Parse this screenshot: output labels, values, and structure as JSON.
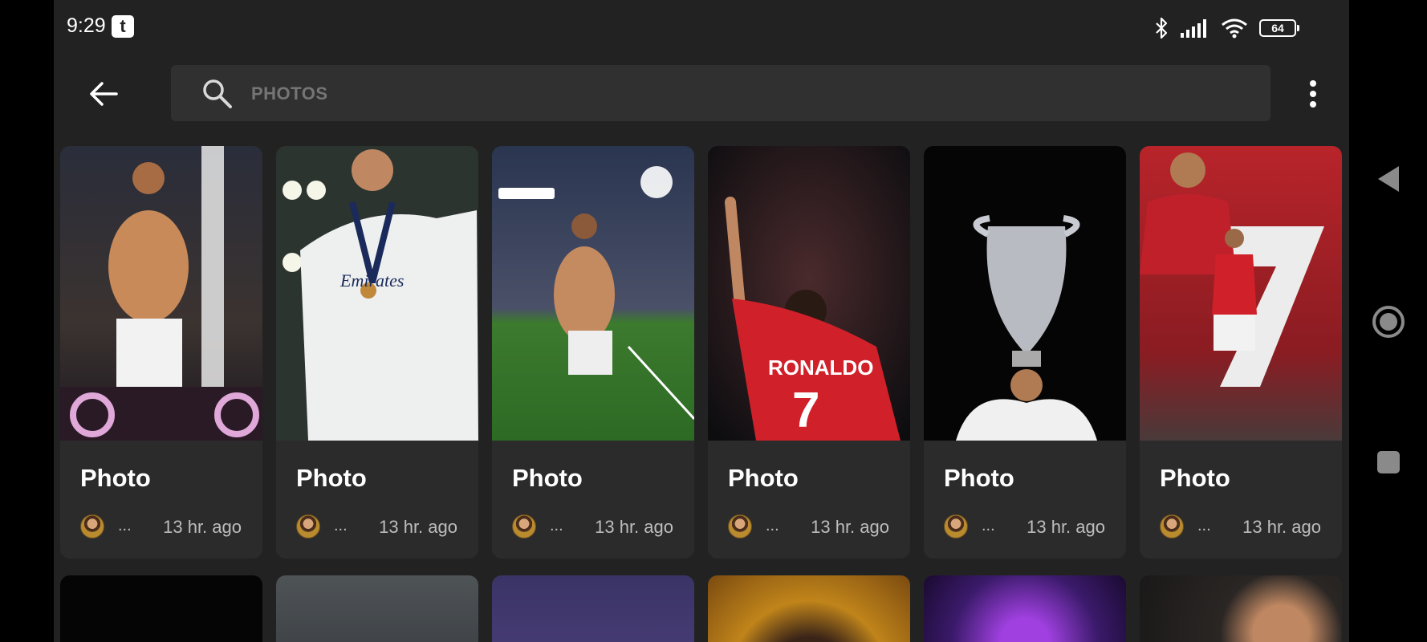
{
  "status_bar": {
    "time": "9:29",
    "battery_level": "64",
    "notification_app_icon": "tumblr-icon"
  },
  "toolbar": {
    "back_icon": "arrow-left-icon",
    "search_placeholder": "PHOTOS",
    "more_icon": "more-vertical-icon"
  },
  "cards": [
    {
      "title": "Photo",
      "author": "...",
      "time": "13 hr. ago"
    },
    {
      "title": "Photo",
      "author": "...",
      "time": "13 hr. ago"
    },
    {
      "title": "Photo",
      "author": "...",
      "time": "13 hr. ago"
    },
    {
      "title": "Photo",
      "author": "...",
      "time": "13 hr. ago"
    },
    {
      "title": "Photo",
      "author": "...",
      "time": "13 hr. ago"
    },
    {
      "title": "Photo",
      "author": "...",
      "time": "13 hr. ago"
    }
  ],
  "nav_bar": {
    "back": "triangle-back-icon",
    "home": "circle-home-icon",
    "recents": "square-recents-icon"
  }
}
